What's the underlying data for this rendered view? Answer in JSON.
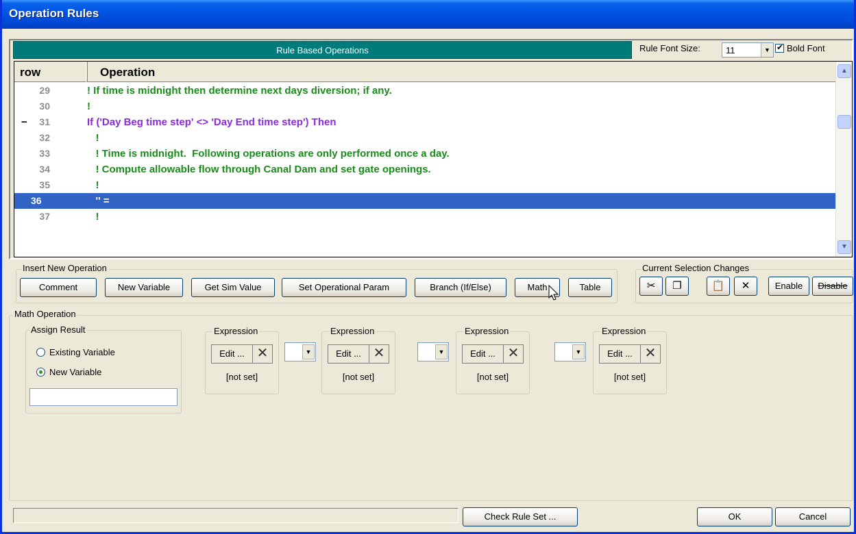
{
  "window": {
    "title": "Operation Rules"
  },
  "top": {
    "banner": "Rule Based Operations",
    "font_size_label": "Rule Font Size:",
    "font_size_value": "11",
    "bold_font_label": "Bold Font",
    "bold_font_checked": true
  },
  "grid": {
    "col_row": "row",
    "col_operation": "Operation",
    "rows": [
      {
        "num": "29",
        "text": "! If time is midnight then determine next days diversion; if any.",
        "color": "green"
      },
      {
        "num": "30",
        "text": "!",
        "color": "green"
      },
      {
        "num": "31",
        "text": "If ('Day Beg time step' <> 'Day End time step') Then",
        "color": "purple",
        "collapse": "−"
      },
      {
        "num": "32",
        "text": "   !",
        "color": "green"
      },
      {
        "num": "33",
        "text": "   ! Time is midnight.  Following operations are only performed once a day.",
        "color": "green"
      },
      {
        "num": "34",
        "text": "   ! Compute allowable flow through Canal Dam and set gate openings.",
        "color": "green"
      },
      {
        "num": "35",
        "text": "   !",
        "color": "green"
      },
      {
        "num": "36",
        "text": "   '' =",
        "color": "white",
        "selected": true
      },
      {
        "num": "37",
        "text": "   !",
        "color": "green"
      }
    ]
  },
  "insert": {
    "label": "Insert New Operation",
    "buttons": [
      "Comment",
      "New Variable",
      "Get Sim Value",
      "Set Operational Param",
      "Branch (If/Else)",
      "Math",
      "Table"
    ]
  },
  "selection": {
    "label": "Current Selection Changes",
    "enable": "Enable",
    "disable": "Disable"
  },
  "math": {
    "label": "Math Operation",
    "assign_label": "Assign Result",
    "existing_var": "Existing Variable",
    "new_var": "New Variable",
    "new_var_value": "",
    "expressions": [
      {
        "label": "Expression",
        "edit": "Edit ...",
        "value": "[not set]"
      },
      {
        "label": "Expression",
        "edit": "Edit ...",
        "value": "[not set]"
      },
      {
        "label": "Expression",
        "edit": "Edit ...",
        "value": "[not set]"
      },
      {
        "label": "Expression",
        "edit": "Edit ...",
        "value": "[not set]"
      }
    ]
  },
  "footer": {
    "status_text": "",
    "check": "Check Rule Set ...",
    "ok": "OK",
    "cancel": "Cancel"
  },
  "colors": {
    "title_blue": "#0055E5",
    "teal": "#007B7B",
    "selection": "#3163C5",
    "comment_green": "#1A8C1A",
    "keyword_purple": "#8A2BE2"
  }
}
